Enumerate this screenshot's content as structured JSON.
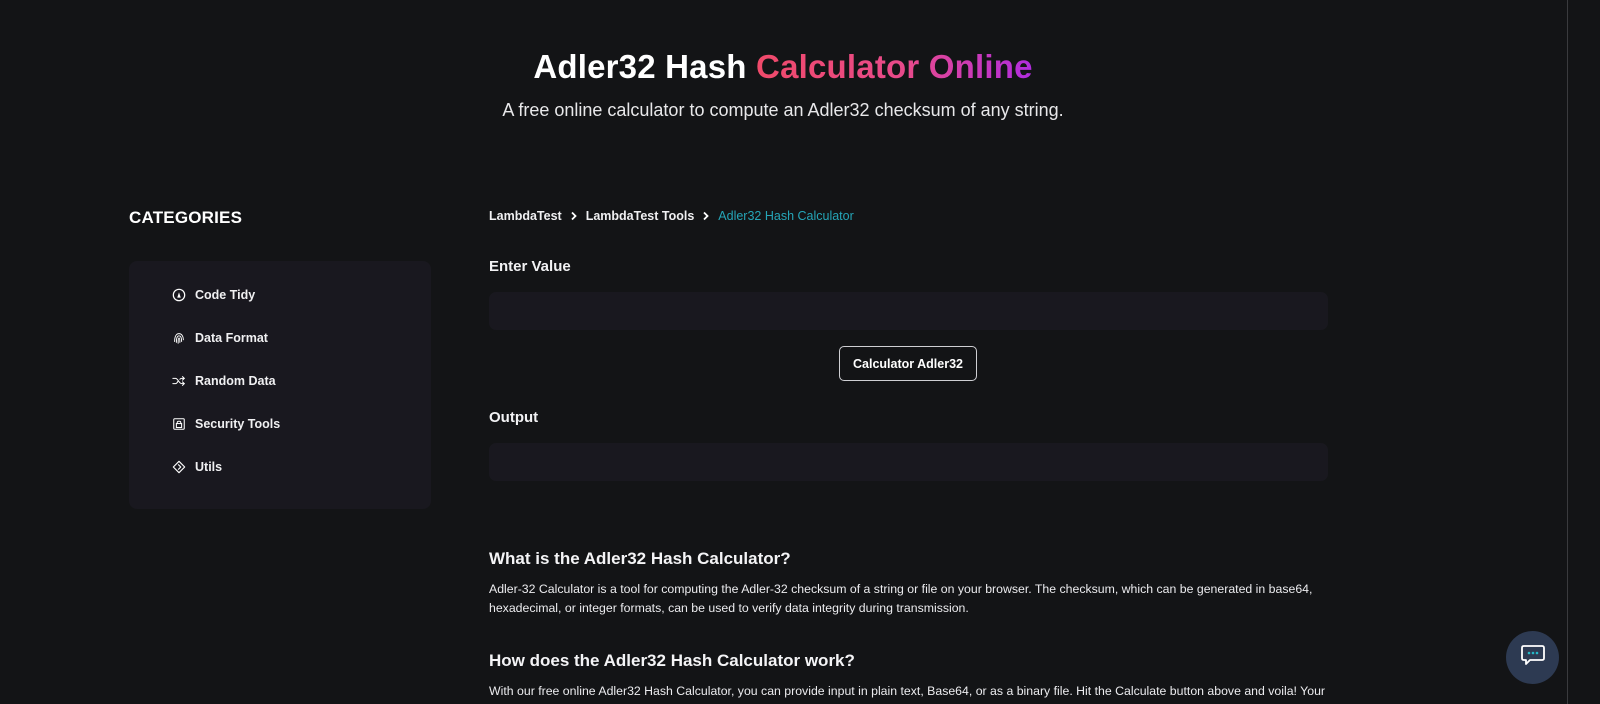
{
  "hero": {
    "title_plain": "Adler32 Hash ",
    "title_highlight": "Calculator Online",
    "subtitle": "A free online calculator to compute an Adler32 checksum of any string."
  },
  "sidebar": {
    "heading": "CATEGORIES",
    "items": [
      {
        "label": "Code Tidy",
        "icon": "code-tidy-icon"
      },
      {
        "label": "Data Format",
        "icon": "fingerprint-icon"
      },
      {
        "label": "Random Data",
        "icon": "shuffle-icon"
      },
      {
        "label": "Security Tools",
        "icon": "lock-icon"
      },
      {
        "label": "Utils",
        "icon": "utils-diamond-icon"
      }
    ]
  },
  "breadcrumb": {
    "items": [
      "LambdaTest",
      "LambdaTest Tools"
    ],
    "current": "Adler32 Hash Calculator"
  },
  "form": {
    "input_label": "Enter Value",
    "input_value": "",
    "input_placeholder": "",
    "button_label": "Calculator Adler32",
    "output_label": "Output",
    "output_value": ""
  },
  "content": {
    "sections": [
      {
        "title": "What is the Adler32 Hash Calculator?",
        "body": "Adler-32 Calculator is a tool for computing the Adler-32 checksum of a string or file on your browser. The checksum, which can be generated in base64, hexadecimal, or integer formats, can be used to verify data integrity during transmission."
      },
      {
        "title": "How does the Adler32 Hash Calculator work?",
        "body": "With our free online Adler32 Hash Calculator, you can provide input in plain text, Base64, or as a binary file. Hit the Calculate button above and voila! Your"
      }
    ]
  },
  "colors": {
    "background": "#131416",
    "panel": "#19181f",
    "accent_link": "#25a5b7",
    "gradient_start": "#f04a6a",
    "gradient_end": "#b12ce0",
    "chat_button": "#2d3a52"
  },
  "chat": {
    "icon": "chat-bubble-icon"
  }
}
